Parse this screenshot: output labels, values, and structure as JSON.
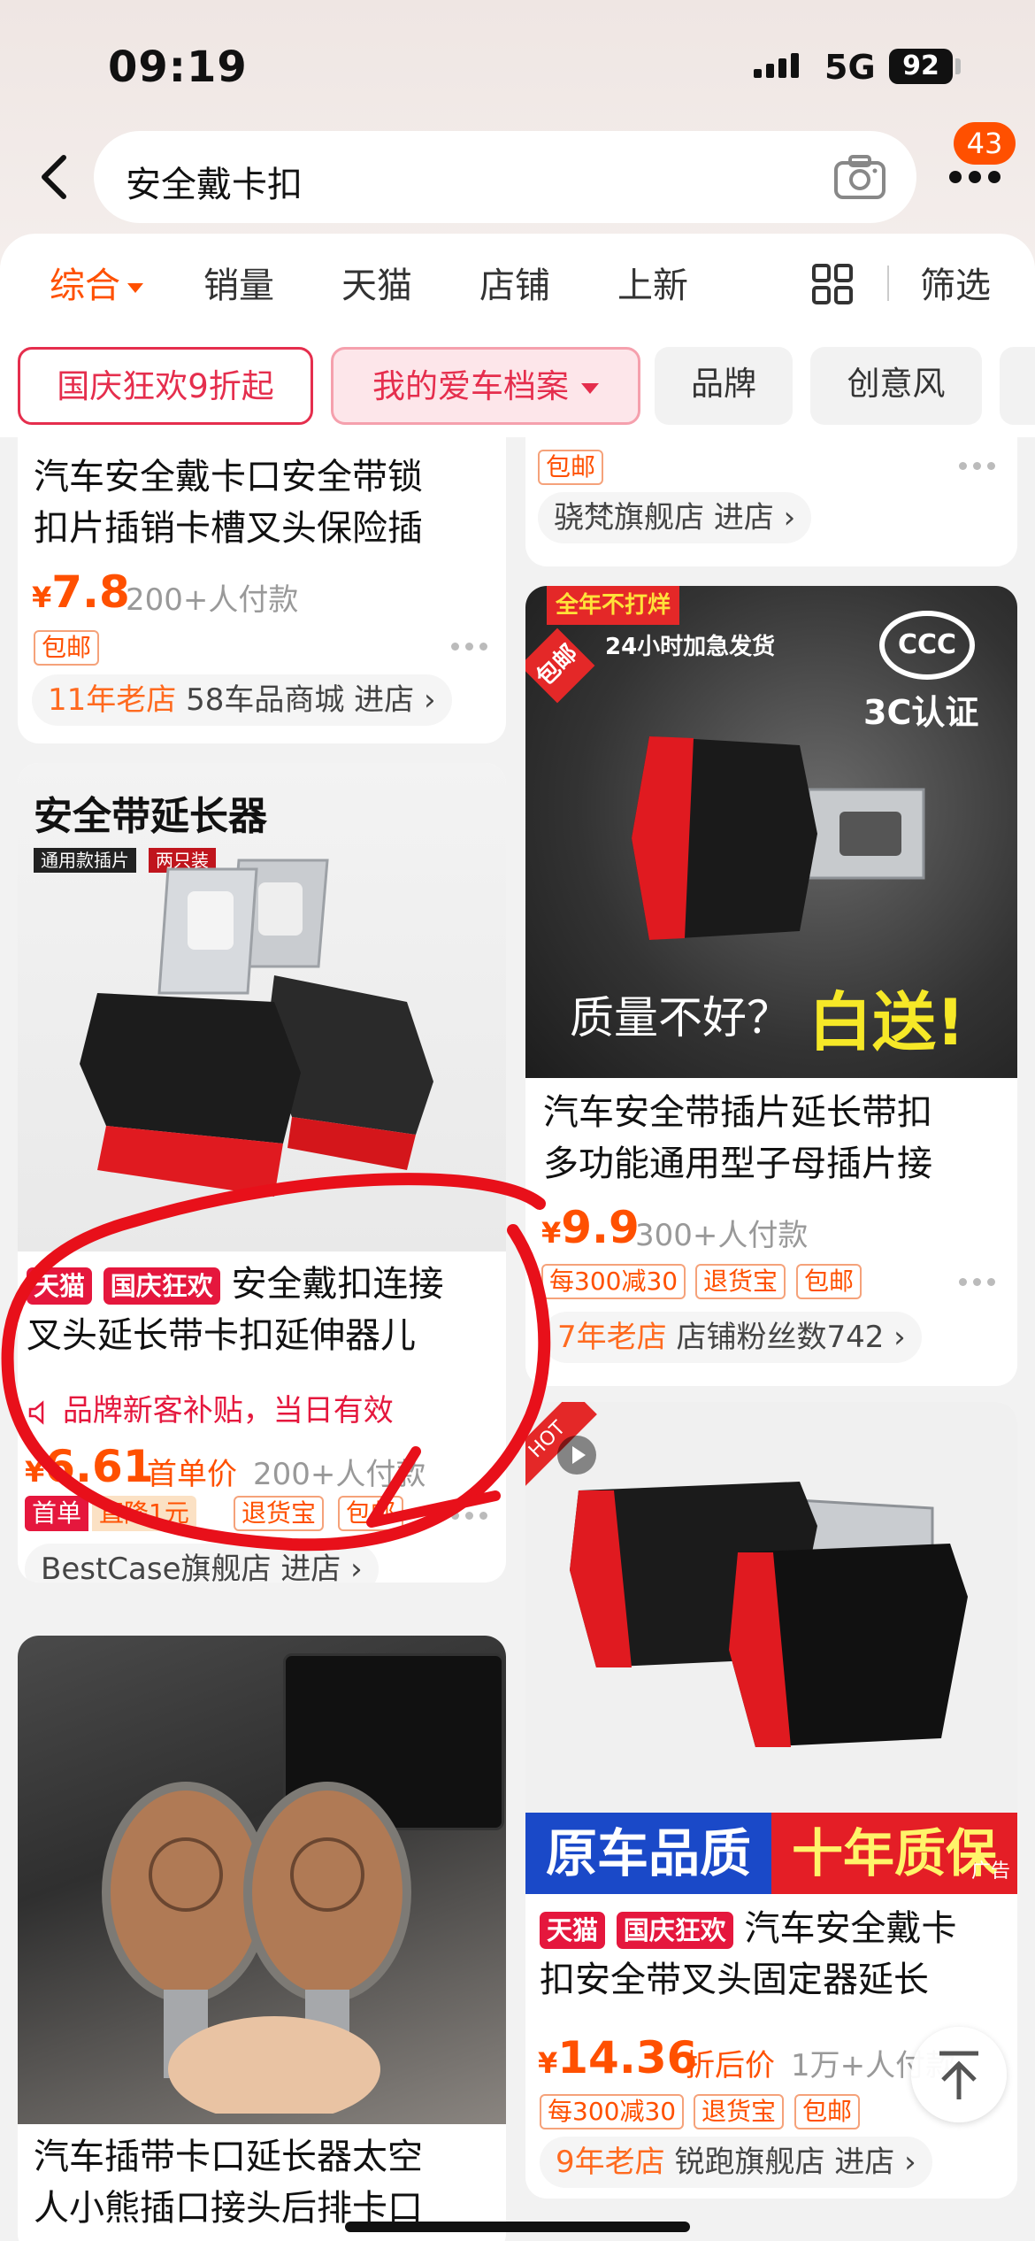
{
  "status": {
    "time": "09:19",
    "network": "5G",
    "battery": "92"
  },
  "search": {
    "query": "安全戴卡扣",
    "notification_count": "43"
  },
  "sort_tabs": {
    "comprehensive": "综合",
    "sales": "销量",
    "tmall": "天猫",
    "shops": "店铺",
    "new": "上新",
    "filter": "筛选"
  },
  "chips": [
    "国庆狂欢9折起",
    "我的爱车档案",
    "品牌",
    "创意风"
  ],
  "products": [
    {
      "title_line1": "汽车安全戴卡口安全带锁",
      "title_line2": "扣片插销卡槽叉头保险插",
      "price_currency": "¥",
      "price": "7.8",
      "sold": "200+人付款",
      "tag": "包邮",
      "store_age": "11年老店",
      "store_name": "58车品商城",
      "store_link": "进店",
      "store_arrow": "›"
    },
    {
      "tag": "包邮",
      "store_name": "骁梵旗舰店",
      "store_link": "进店",
      "store_arrow": "›"
    },
    {
      "image_header": "安全带延长器",
      "image_tag1": "通用款插片",
      "image_tag2": "两只装",
      "badge_tmall": "天猫",
      "badge_event": "国庆狂欢",
      "title_line1": "安全戴扣连接",
      "title_line2": "叉头延长带卡扣延伸器儿",
      "promo": "品牌新客补贴，当日有效",
      "price_currency": "¥",
      "price": "6.61",
      "price_note": "首单价",
      "sold": "200+人付款",
      "tags": [
        "首单",
        "直降1元",
        "退货宝",
        "包邮"
      ],
      "store_name": "BestCase旗舰店",
      "store_link": "进店",
      "store_arrow": "›"
    },
    {
      "image_corner": "全年不打烊",
      "image_corner2": "包邮",
      "image_ship": "24小时加急发货",
      "image_cert_mark": "CCC",
      "image_cert": "3C认证",
      "image_slogan_a": "质量不好？",
      "image_slogan_b": "白送!",
      "title_line1": "汽车安全带插片延长带扣",
      "title_line2": "多功能通用型子母插片接",
      "price_currency": "¥",
      "price": "9.9",
      "sold": "300+人付款",
      "tags": [
        "每300减30",
        "退货宝",
        "包邮"
      ],
      "store_age": "7年老店",
      "store_name": "店铺粉丝数742",
      "store_arrow": "›"
    },
    {
      "image_hot": "HOT",
      "image_banner_a": "原车品质",
      "image_banner_b": "十年质保",
      "ad_label": "广告",
      "badge_tmall": "天猫",
      "badge_event": "国庆狂欢",
      "title_line1": "汽车安全戴卡",
      "title_line2": "扣安全带叉头固定器延长",
      "price_currency": "¥",
      "price": "14.36",
      "price_note": "折后价",
      "sold": "1万+人付款",
      "tags": [
        "每300减30",
        "退货宝",
        "包邮"
      ],
      "store_age": "9年老店",
      "store_name": "锐跑旗舰店",
      "store_link": "进店",
      "store_arrow": "›"
    },
    {
      "title_line1": "汽车插带卡口延长器太空",
      "title_line2": "人小熊插口接头后排卡口"
    }
  ],
  "colors": {
    "accent": "#ff5000",
    "tmall_red": "#e5173d",
    "annotation_red": "#e8101a"
  },
  "icons": [
    "back-icon",
    "camera-icon",
    "more-icon",
    "grid-view-icon",
    "speaker-icon",
    "scroll-top-icon",
    "play-icon"
  ]
}
